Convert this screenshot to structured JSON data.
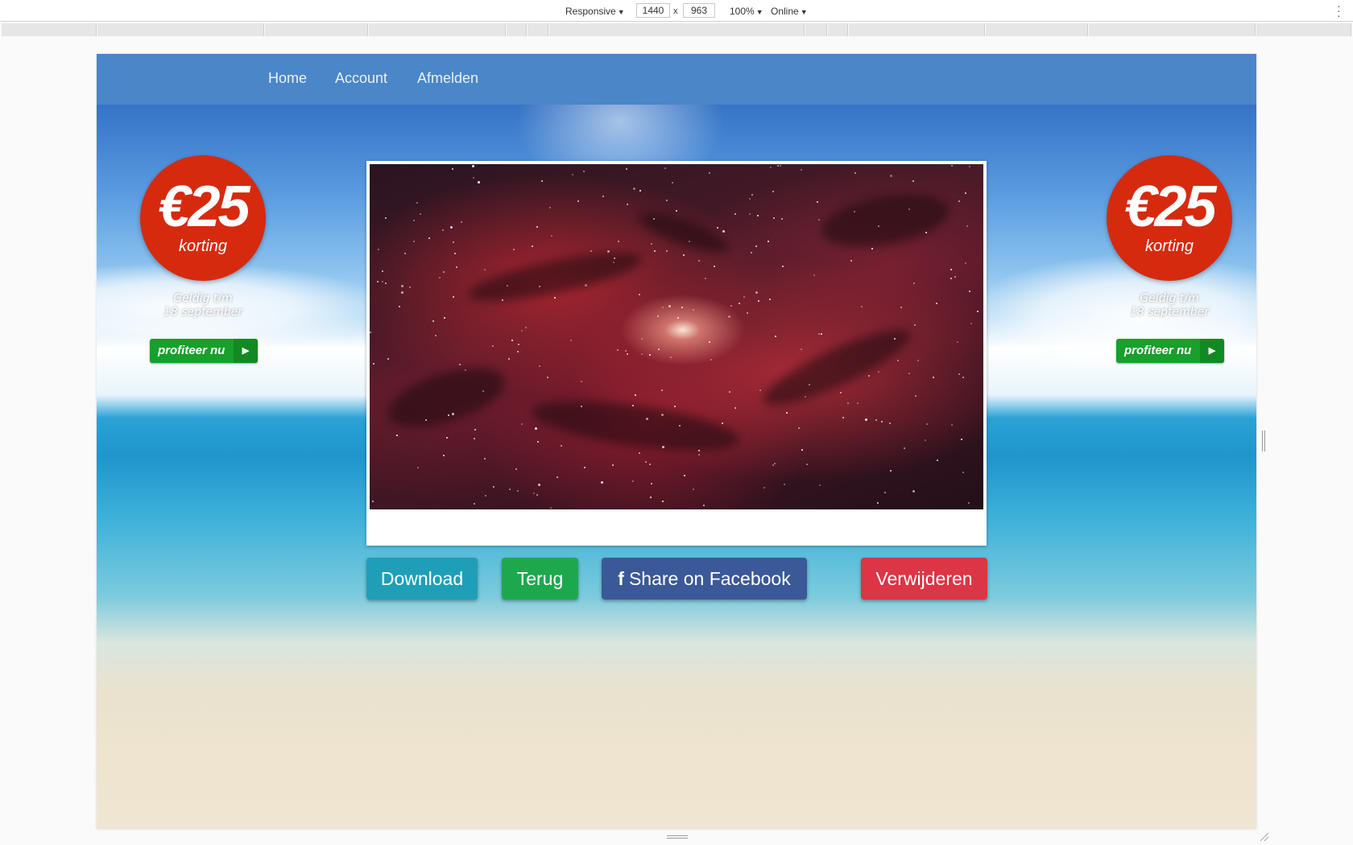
{
  "devtools": {
    "device_mode": "Responsive",
    "width": "1440",
    "height": "963",
    "separator": "x",
    "zoom": "100%",
    "throttling": "Online"
  },
  "nav": {
    "items": [
      {
        "label": "Home"
      },
      {
        "label": "Account"
      },
      {
        "label": "Afmelden"
      }
    ]
  },
  "promo_left": {
    "amount": "€25",
    "discount_label": "korting",
    "valid_line1": "Geldig t/m",
    "valid_line2": "18 september",
    "cta_label": "profiteer nu"
  },
  "promo_right": {
    "amount": "€25",
    "discount_label": "korting",
    "valid_line1": "Geldig t/m",
    "valid_line2": "18 september",
    "cta_label": "profiteer nu"
  },
  "actions": {
    "download_label": "Download",
    "back_label": "Terug",
    "facebook_icon": "f",
    "facebook_label": "Share on Facebook",
    "delete_label": "Verwijderen"
  },
  "colors": {
    "navbar": "#4a86c8",
    "download": "#1f9fb7",
    "back": "#1da84e",
    "facebook": "#3b5998",
    "delete": "#dc3545",
    "badge": "#d62a0f",
    "cta": "#17a02a"
  }
}
